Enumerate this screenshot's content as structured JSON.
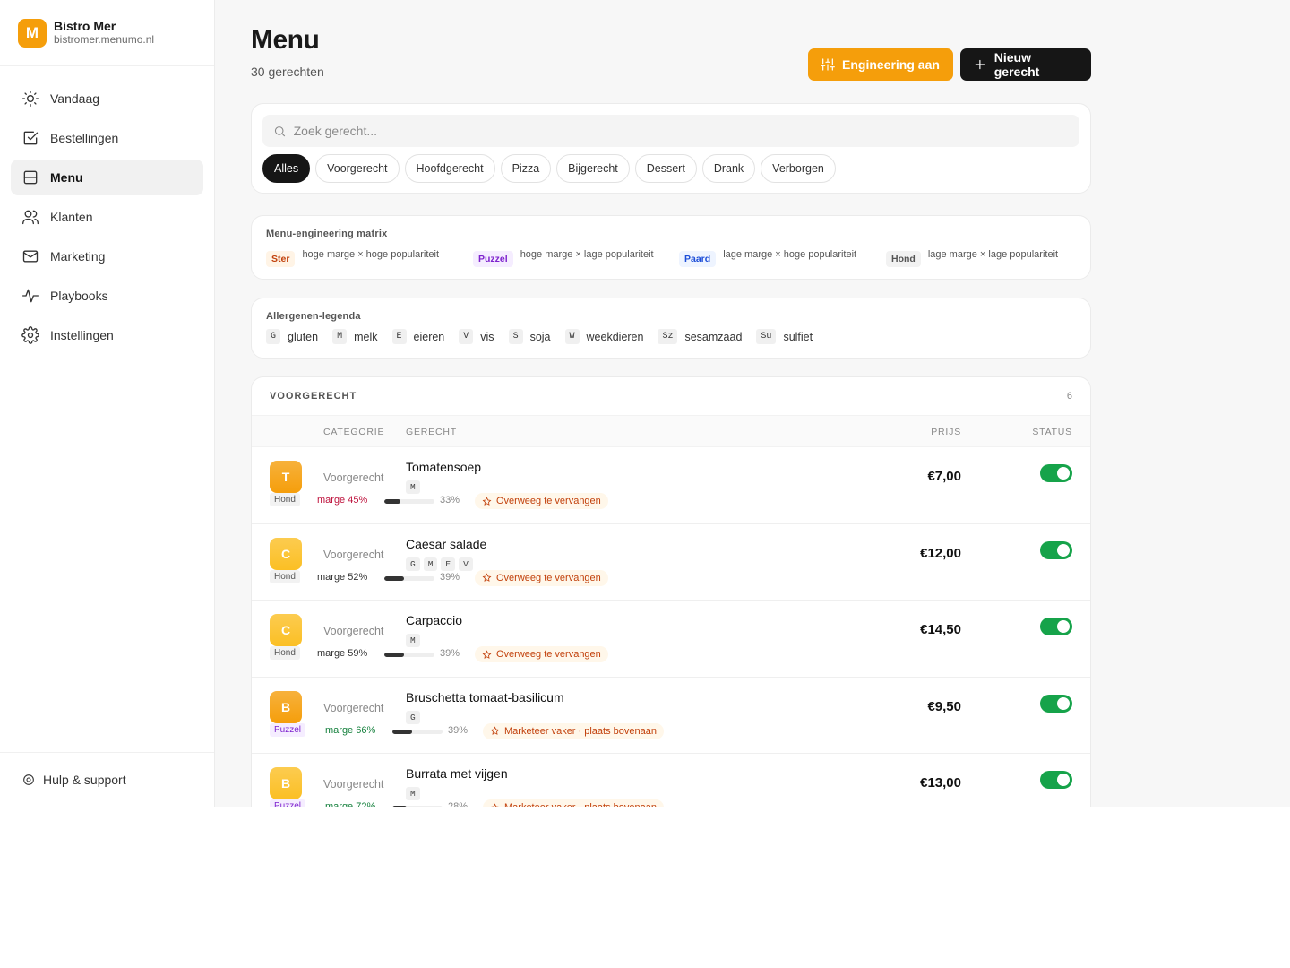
{
  "brand": {
    "initial": "M",
    "name": "Bistro Mer",
    "domain": "bistromer.menumo.nl"
  },
  "nav": [
    {
      "label": "Vandaag",
      "icon": "sun-icon"
    },
    {
      "label": "Bestellingen",
      "icon": "checklist-icon"
    },
    {
      "label": "Menu",
      "icon": "menu-icon",
      "active": true
    },
    {
      "label": "Klanten",
      "icon": "users-icon"
    },
    {
      "label": "Marketing",
      "icon": "mail-icon"
    },
    {
      "label": "Playbooks",
      "icon": "pulse-icon"
    },
    {
      "label": "Instellingen",
      "icon": "gear-icon"
    }
  ],
  "help": {
    "label": "Hulp & support",
    "icon": "gear-icon"
  },
  "header": {
    "title": "Menu",
    "subtitle": "30 gerechten",
    "engineering_button": "Engineering aan",
    "new_button": "Nieuw gerecht"
  },
  "search": {
    "placeholder": "Zoek gerecht..."
  },
  "filters": [
    "Alles",
    "Voorgerecht",
    "Hoofdgerecht",
    "Pizza",
    "Bijgerecht",
    "Dessert",
    "Drank",
    "Verborgen"
  ],
  "active_filter": "Alles",
  "matrix": {
    "title": "Menu-engineering matrix",
    "items": [
      {
        "tag": "Ster",
        "desc": "hoge marge × hoge populariteit",
        "color": "#c2410c",
        "bg": "#fff4e6"
      },
      {
        "tag": "Puzzel",
        "desc": "hoge marge × lage populariteit",
        "color": "#7e22ce",
        "bg": "#f5edff"
      },
      {
        "tag": "Paard",
        "desc": "lage marge × hoge populariteit",
        "color": "#1d4ed8",
        "bg": "#eef4ff"
      },
      {
        "tag": "Hond",
        "desc": "lage marge × lage populariteit",
        "color": "#555555",
        "bg": "#f2f2f2"
      }
    ]
  },
  "allergens": {
    "title": "Allergenen-legenda",
    "items": [
      {
        "code": "G",
        "label": "gluten"
      },
      {
        "code": "M",
        "label": "melk"
      },
      {
        "code": "E",
        "label": "eieren"
      },
      {
        "code": "V",
        "label": "vis"
      },
      {
        "code": "S",
        "label": "soja"
      },
      {
        "code": "W",
        "label": "weekdieren"
      },
      {
        "code": "Sz",
        "label": "sesamzaad"
      },
      {
        "code": "Su",
        "label": "sulfiet"
      }
    ]
  },
  "table": {
    "group_title": "VOORGERECHT",
    "group_count": "6",
    "headers": {
      "category": "CATEGORIE",
      "dish": "GERECHT",
      "price": "PRIJS",
      "status": "STATUS"
    },
    "rows": [
      {
        "initial": "T",
        "quadrant": "Hond",
        "category": "Voorgerecht",
        "name": "Tomatensoep",
        "allergens": [
          "M"
        ],
        "margin": "marge 45%",
        "margin_color": "#be123c",
        "popularity": 33,
        "popularity_label": "33%",
        "advice": "Overweeg te vervangen",
        "price": "€7,00",
        "active": true,
        "thumb_color": "#f59e0b"
      },
      {
        "initial": "C",
        "quadrant": "Hond",
        "category": "Voorgerecht",
        "name": "Caesar salade",
        "allergens": [
          "G",
          "M",
          "E",
          "V"
        ],
        "margin": "marge 52%",
        "margin_color": "#333333",
        "popularity": 39,
        "popularity_label": "39%",
        "advice": "Overweeg te vervangen",
        "price": "€12,00",
        "active": true,
        "thumb_color": "#fbbf24"
      },
      {
        "initial": "C",
        "quadrant": "Hond",
        "category": "Voorgerecht",
        "name": "Carpaccio",
        "allergens": [
          "M"
        ],
        "margin": "marge 59%",
        "margin_color": "#333333",
        "popularity": 39,
        "popularity_label": "39%",
        "advice": "Overweeg te vervangen",
        "price": "€14,50",
        "active": true,
        "thumb_color": "#fbbf24"
      },
      {
        "initial": "B",
        "quadrant": "Puzzel",
        "category": "Voorgerecht",
        "name": "Bruschetta tomaat-basilicum",
        "allergens": [
          "G"
        ],
        "margin": "marge 66%",
        "margin_color": "#15803d",
        "popularity": 39,
        "popularity_label": "39%",
        "advice": "Marketeer vaker · plaats bovenaan",
        "price": "€9,50",
        "active": true,
        "thumb_color": "#f59e0b"
      },
      {
        "initial": "B",
        "quadrant": "Puzzel",
        "category": "Voorgerecht",
        "name": "Burrata met vijgen",
        "allergens": [
          "M"
        ],
        "margin": "marge 72%",
        "margin_color": "#15803d",
        "popularity": 28,
        "popularity_label": "28%",
        "advice": "Marketeer vaker · plaats bovenaan",
        "price": "€13,00",
        "active": true,
        "thumb_color": "#fbbf24"
      }
    ]
  }
}
